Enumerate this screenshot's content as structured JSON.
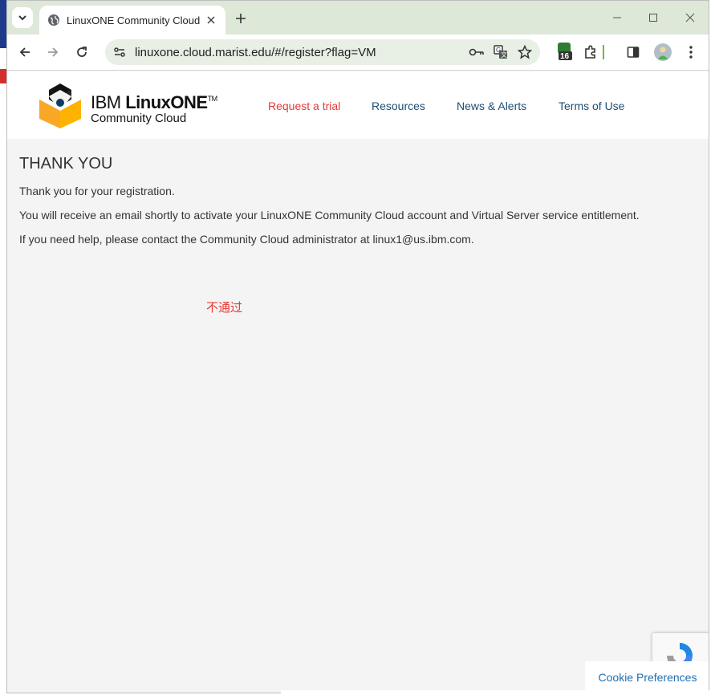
{
  "browser": {
    "tab_title": "LinuxONE Community Cloud",
    "url": "linuxone.cloud.marist.edu/#/register?flag=VM",
    "extension_badge": "16"
  },
  "header": {
    "brand_ibm": "IBM ",
    "brand_name": "LinuxONE",
    "brand_tm": "TM",
    "brand_sub": "Community Cloud",
    "nav": [
      {
        "label": "Request a trial",
        "color": "#e53935"
      },
      {
        "label": "Resources",
        "color": "#1d4f73"
      },
      {
        "label": "News & Alerts",
        "color": "#1d4f73"
      },
      {
        "label": "Terms of Use",
        "color": "#1d4f73"
      }
    ]
  },
  "main": {
    "heading": "THANK YOU",
    "lines": [
      "Thank you for your registration.",
      "You will receive an email shortly to activate your LinuxONE Community Cloud account and Virtual Server service entitlement.",
      "If you need help, please contact the Community Cloud administrator at linux1@us.ibm.com."
    ],
    "annotation": "不通过"
  },
  "footer": {
    "cookie_label": "Cookie Preferences"
  },
  "colors": {
    "titlebar": "#dde8d8",
    "page_bg": "#f4f4f4",
    "accent_red": "#e53935",
    "link_blue": "#1d4f73"
  }
}
